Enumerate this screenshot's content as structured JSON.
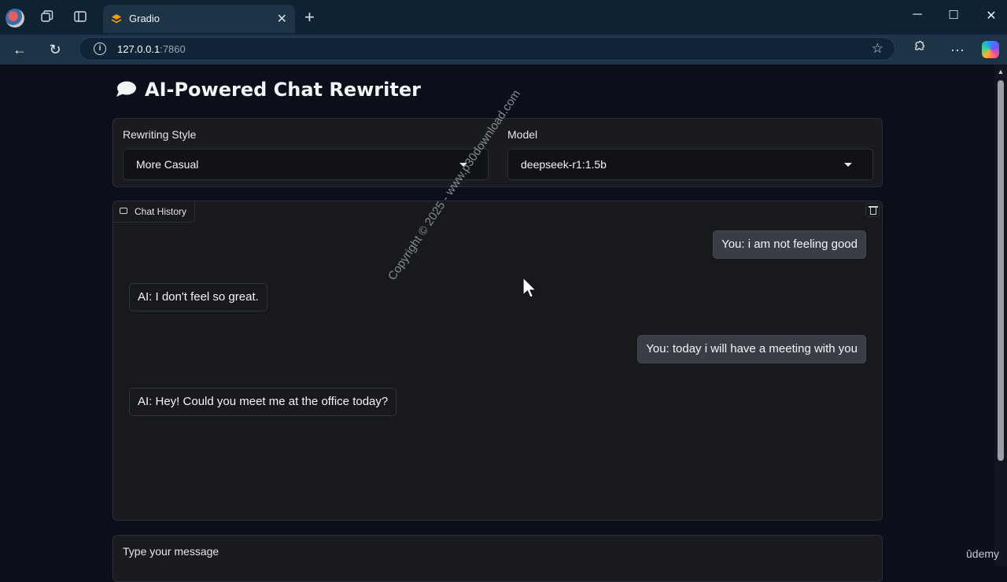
{
  "browser": {
    "tab_title": "Gradio",
    "url_host": "127.0.0.1",
    "url_port": ":7860"
  },
  "app": {
    "title": "AI-Powered Chat Rewriter",
    "style_label": "Rewriting Style",
    "style_value": "More Casual",
    "model_label": "Model",
    "model_value": "deepseek-r1:1.5b",
    "chat_label": "Chat History",
    "input_label": "Type your message",
    "messages": [
      {
        "role": "user",
        "text": "You: i am not feeling good"
      },
      {
        "role": "bot",
        "text": "AI: I don't feel so great."
      },
      {
        "role": "user",
        "text": "You: today i will have a meeting with you"
      },
      {
        "role": "bot",
        "text": "AI: Hey! Could you meet me at the office today?"
      }
    ]
  },
  "overlay": {
    "watermark": "Copyright © 2025 - www.p30download.com",
    "udemy": "ûdemy"
  },
  "icons": [
    "profile-icon",
    "workspaces-icon",
    "tab-actions-icon",
    "gradio-favicon",
    "close-icon",
    "plus-icon",
    "minimize-icon",
    "maximize-icon",
    "window-close-icon",
    "back-icon",
    "refresh-icon",
    "info-icon",
    "star-icon",
    "extensions-icon",
    "more-icon",
    "copilot-icon",
    "chat-bubble-icon",
    "trash-icon",
    "cursor-icon"
  ]
}
